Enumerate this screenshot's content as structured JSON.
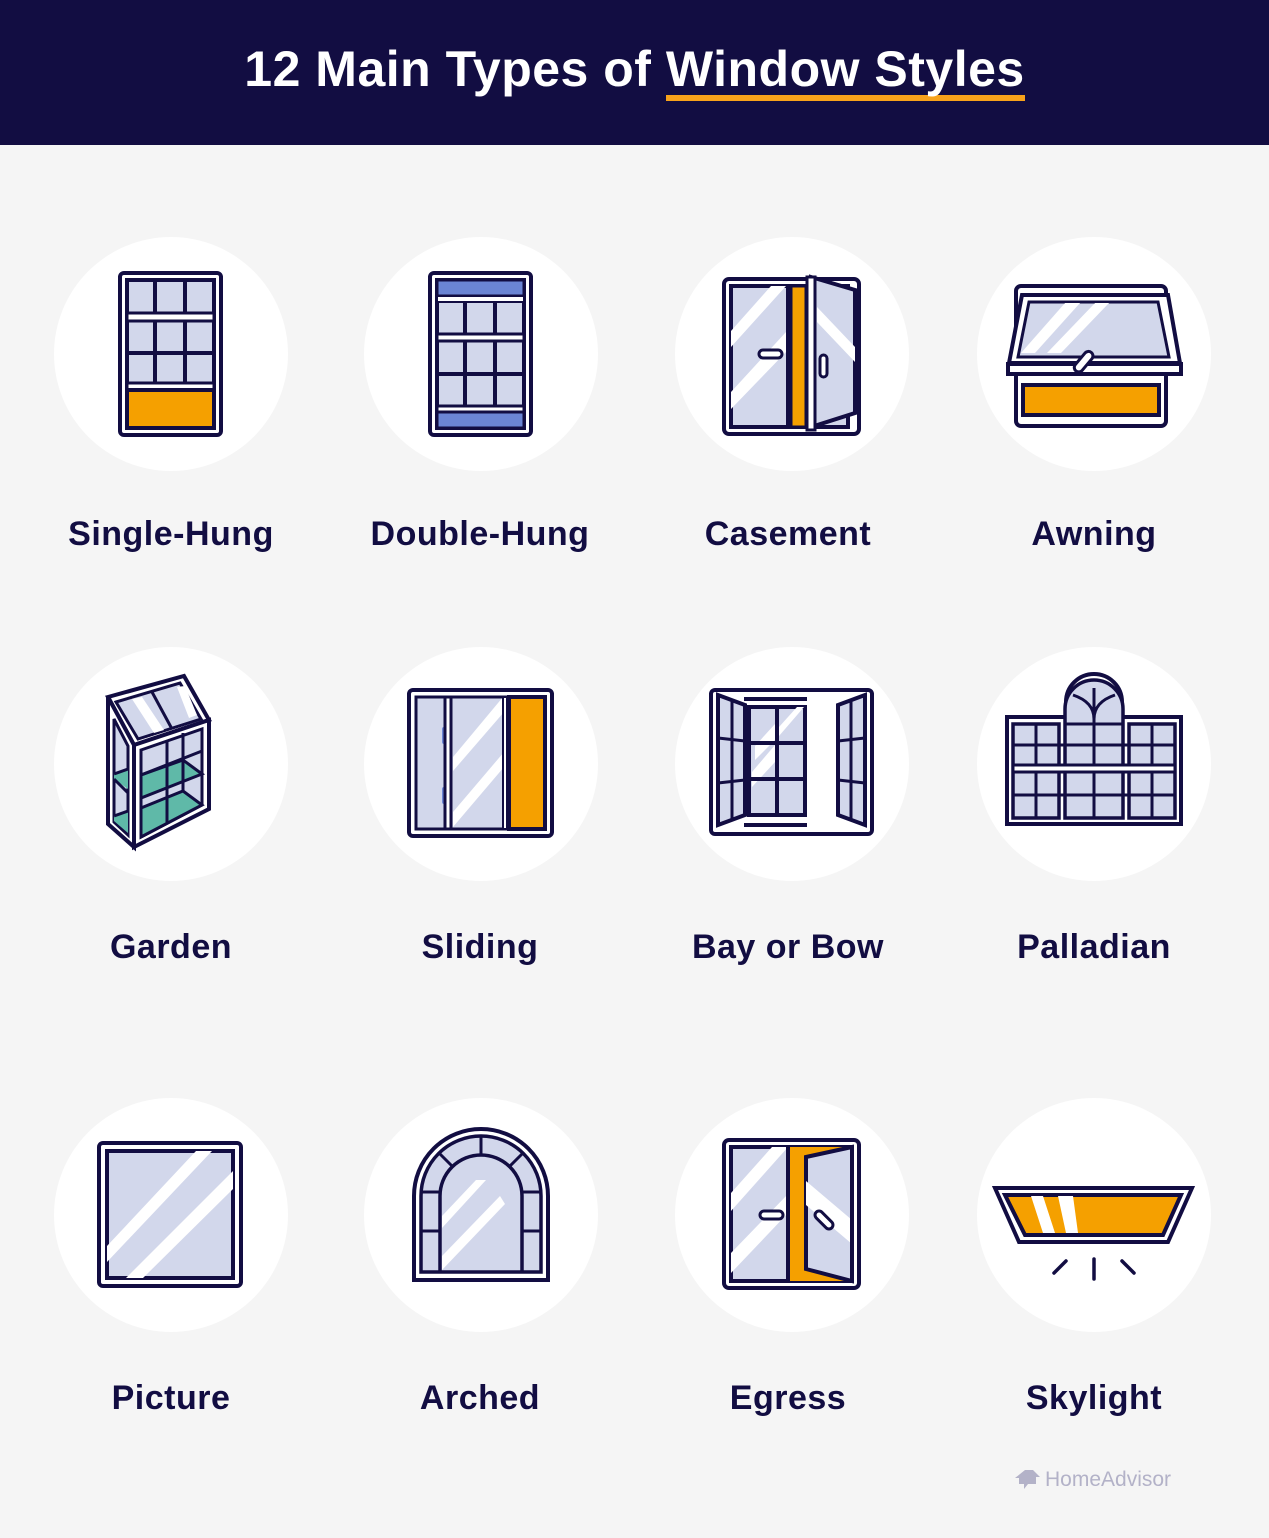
{
  "header": {
    "title_prefix": "12 Main Types of ",
    "title_highlight": "Window Styles"
  },
  "colors": {
    "navy": "#120d42",
    "accent_orange": "#f5a000",
    "glass": "#d2d7eb",
    "blue": "#6b85d4",
    "green": "#5fb9a8",
    "background": "#f5f5f5"
  },
  "window_types": [
    {
      "label": "Single-Hung",
      "icon": "single-hung-window-icon"
    },
    {
      "label": "Double-Hung",
      "icon": "double-hung-window-icon"
    },
    {
      "label": "Casement",
      "icon": "casement-window-icon"
    },
    {
      "label": "Awning",
      "icon": "awning-window-icon"
    },
    {
      "label": "Garden",
      "icon": "garden-window-icon"
    },
    {
      "label": "Sliding",
      "icon": "sliding-window-icon"
    },
    {
      "label": "Bay or Bow",
      "icon": "bay-bow-window-icon"
    },
    {
      "label": "Palladian",
      "icon": "palladian-window-icon"
    },
    {
      "label": "Picture",
      "icon": "picture-window-icon"
    },
    {
      "label": "Arched",
      "icon": "arched-window-icon"
    },
    {
      "label": "Egress",
      "icon": "egress-window-icon"
    },
    {
      "label": "Skylight",
      "icon": "skylight-window-icon"
    }
  ],
  "footer": {
    "brand": "HomeAdvisor",
    "brand_icon": "homeadvisor-logo-icon"
  }
}
